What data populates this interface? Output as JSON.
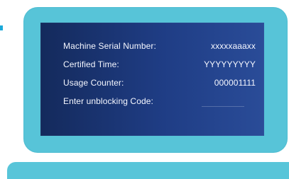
{
  "panel": {
    "rows": [
      {
        "label": "Machine Serial Number:",
        "value": "xxxxxaaaxx"
      },
      {
        "label": "Certified Time:",
        "value": "YYYYYYYYY"
      },
      {
        "label": "Usage Counter:",
        "value": "000001111"
      },
      {
        "label": "Enter unblocking Code:",
        "value": ""
      }
    ]
  },
  "colors": {
    "frame": "#57c4d8",
    "panel_start": "#142a5c",
    "panel_end": "#2a4c98",
    "text": "#f5f7ff"
  }
}
